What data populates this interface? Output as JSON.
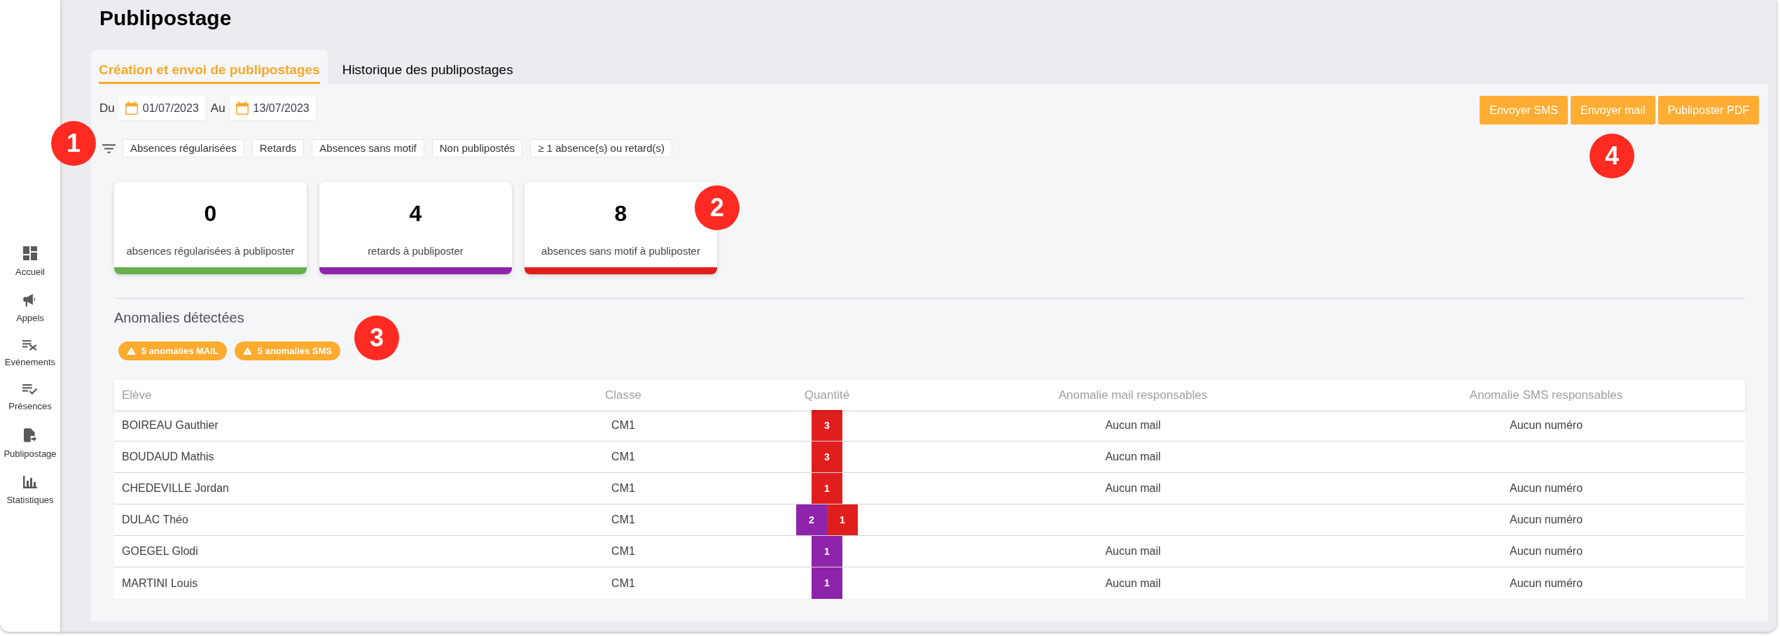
{
  "sidebar": {
    "items": [
      {
        "label": "Accueil"
      },
      {
        "label": "Appels"
      },
      {
        "label": "Evénements"
      },
      {
        "label": "Présences"
      },
      {
        "label": "Publipostage"
      },
      {
        "label": "Statistiques"
      }
    ]
  },
  "page": {
    "title": "Publipostage"
  },
  "tabs": [
    {
      "label": "Création et envoi de publipostages",
      "selected": true
    },
    {
      "label": "Historique des publipostages",
      "selected": false
    }
  ],
  "date_range": {
    "from_label": "Du",
    "from": "01/07/2023",
    "to_label": "Au",
    "to": "13/07/2023"
  },
  "actions": [
    {
      "label": "Envoyer SMS"
    },
    {
      "label": "Envoyer mail"
    },
    {
      "label": "Publiposter PDF"
    }
  ],
  "filters": [
    {
      "label": "Absences régularisées"
    },
    {
      "label": "Retards"
    },
    {
      "label": "Absences sans motif"
    },
    {
      "label": "Non publipostés"
    },
    {
      "label": "≥ 1 absence(s) ou retard(s)"
    }
  ],
  "summary_cards": [
    {
      "count": "0",
      "label": "absences régularisées à publiposter",
      "color": "#66b04d"
    },
    {
      "count": "4",
      "label": "retards à publiposter",
      "color": "#8e24aa"
    },
    {
      "count": "8",
      "label": "absences sans motif à publiposter",
      "color": "#e01e1e"
    }
  ],
  "anomalies": {
    "title": "Anomalies détectées",
    "badges": [
      {
        "label": "5 anomalies MAIL"
      },
      {
        "label": "5 anomalies SMS"
      }
    ]
  },
  "table": {
    "columns": [
      "Elève",
      "Classe",
      "Quantité",
      "Anomalie mail responsables",
      "Anomalie SMS responsables"
    ],
    "rows": [
      {
        "student": "BOIREAU Gauthier",
        "class": "CM1",
        "quantity": [
          {
            "value": "3",
            "color": "#e01e1e"
          }
        ],
        "mail_anomaly": "Aucun mail",
        "sms_anomaly": "Aucun numéro"
      },
      {
        "student": "BOUDAUD Mathis",
        "class": "CM1",
        "quantity": [
          {
            "value": "3",
            "color": "#e01e1e"
          }
        ],
        "mail_anomaly": "Aucun mail"
      },
      {
        "student": "CHEDEVILLE Jordan",
        "class": "CM1",
        "quantity": [
          {
            "value": "1",
            "color": "#e01e1e"
          }
        ],
        "mail_anomaly": "Aucun mail",
        "sms_anomaly": "Aucun numéro"
      },
      {
        "student": "DULAC Théo",
        "class": "CM1",
        "quantity": [
          {
            "value": "2",
            "color": "#8e24aa"
          },
          {
            "value": "1",
            "color": "#e01e1e"
          }
        ],
        "sms_anomaly": "Aucun numéro"
      },
      {
        "student": "GOEGEL Glodi",
        "class": "CM1",
        "quantity": [
          {
            "value": "1",
            "color": "#8e24aa"
          }
        ],
        "mail_anomaly": "Aucun mail",
        "sms_anomaly": "Aucun numéro"
      },
      {
        "student": "MARTINI Louis",
        "class": "CM1",
        "quantity": [
          {
            "value": "1",
            "color": "#8e24aa"
          }
        ],
        "mail_anomaly": "Aucun mail",
        "sms_anomaly": "Aucun numéro"
      }
    ]
  },
  "callouts": [
    {
      "number": "1"
    },
    {
      "number": "2"
    },
    {
      "number": "3"
    },
    {
      "number": "4"
    }
  ]
}
